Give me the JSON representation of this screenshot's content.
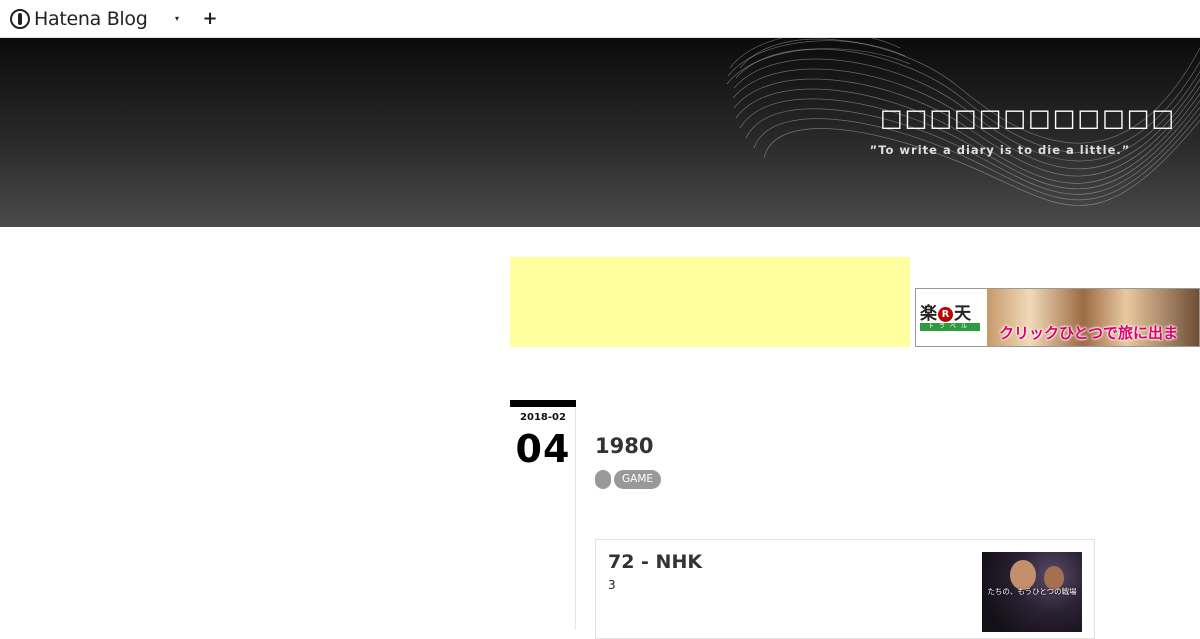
{
  "topbar": {
    "logo_text": "Hatena Blog",
    "menu_caret": "▾",
    "add_symbol": "+"
  },
  "header": {
    "blog_title": "□□□□□□□□□□□□",
    "description": "”To write a diary is to die a little.”"
  },
  "ad": {
    "logo_main_left": "楽",
    "logo_r": "R",
    "logo_main_right": "天",
    "logo_sub": "トラベル",
    "banner_text": "クリックひとつで旅に出ま"
  },
  "entry": {
    "year_month": "2018-02",
    "day": "04",
    "title": "1980",
    "category": "GAME",
    "embed": {
      "title": "72 - NHK",
      "description": "3",
      "thumbnail_caption": "たちの、もうひとつの戦場"
    }
  },
  "colors": {
    "header_dark": "#0b0b0b",
    "header_light": "#4b4b4b",
    "ad_yellow": "#ffff9f",
    "category_gray": "#999999",
    "rakuten_red": "#bf0000"
  }
}
